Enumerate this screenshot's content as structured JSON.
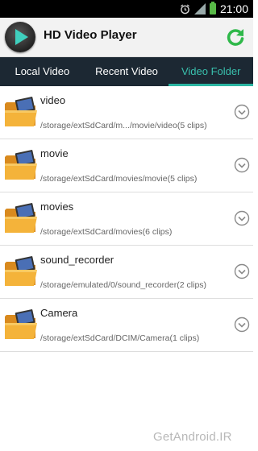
{
  "status_bar": {
    "time": "21:00",
    "icons": [
      "alarm-icon",
      "signal-icon",
      "battery-icon"
    ]
  },
  "app": {
    "title": "HD Video Player",
    "logo": "play-logo-icon",
    "accent": "#2bb5a2"
  },
  "tabs": [
    {
      "label": "Local Video",
      "active": false
    },
    {
      "label": "Recent Video",
      "active": false
    },
    {
      "label": "Video Folder",
      "active": true
    }
  ],
  "folders": [
    {
      "name": "video",
      "path": "/storage/extSdCard/m.../movie/video(5 clips)"
    },
    {
      "name": "movie",
      "path": "/storage/extSdCard/movies/movie(5 clips)"
    },
    {
      "name": "movies",
      "path": "/storage/extSdCard/movies(6 clips)"
    },
    {
      "name": "sound_recorder",
      "path": "/storage/emulated/0/sound_recorder(2 clips)"
    },
    {
      "name": "Camera",
      "path": "/storage/extSdCard/DCIM/Camera(1 clips)"
    }
  ],
  "watermark": {
    "prefix": "Get",
    "brand": "Android",
    "suffix": ".IR"
  }
}
